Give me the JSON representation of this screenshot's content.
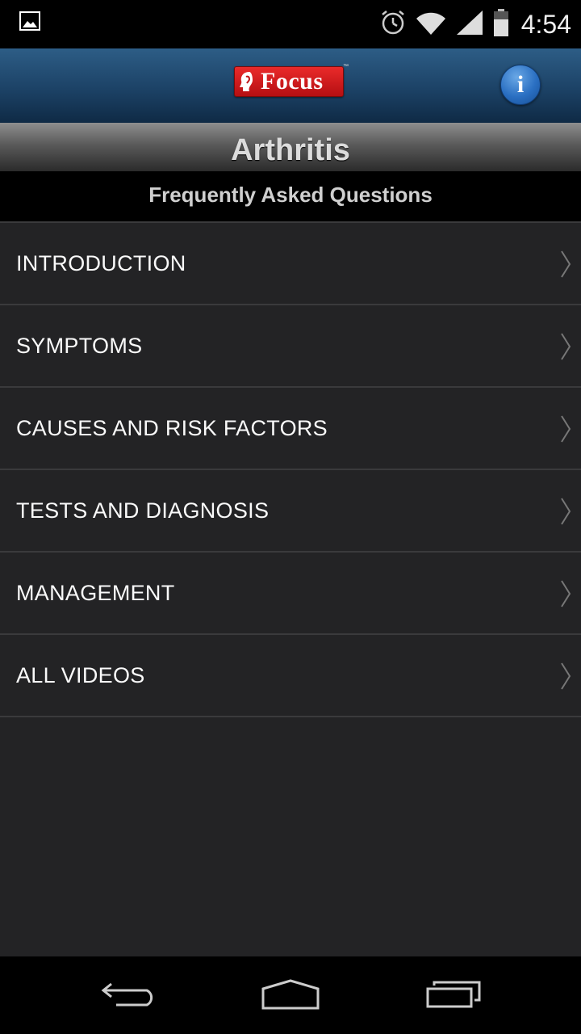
{
  "status_bar": {
    "time": "4:54",
    "icons": [
      "image-notification-icon",
      "alarm-icon",
      "wifi-icon",
      "signal-icon",
      "battery-icon"
    ]
  },
  "header": {
    "logo_text": "Focus",
    "logo_tm": "™",
    "info_label": "i"
  },
  "page": {
    "title": "Arthritis",
    "subtitle": "Frequently Asked Questions"
  },
  "menu": {
    "items": [
      {
        "label": "INTRODUCTION"
      },
      {
        "label": "SYMPTOMS"
      },
      {
        "label": "CAUSES AND RISK FACTORS"
      },
      {
        "label": "TESTS AND DIAGNOSIS"
      },
      {
        "label": "MANAGEMENT"
      },
      {
        "label": "ALL VIDEOS"
      }
    ]
  },
  "nav_bar": {
    "buttons": [
      "back-icon",
      "home-icon",
      "recents-icon"
    ]
  },
  "colors": {
    "header_blue": "#1c4266",
    "logo_red": "#d01c1f",
    "info_blue": "#2a6fc2",
    "list_bg": "#232325"
  }
}
